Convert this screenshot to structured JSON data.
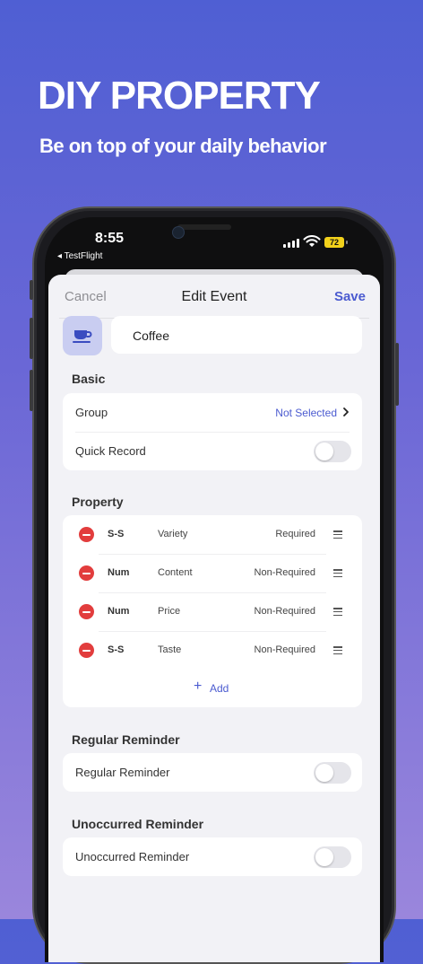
{
  "promo": {
    "headline": "DIY PROPERTY",
    "subhead": "Be on top of your daily behavior"
  },
  "status_bar": {
    "time": "8:55",
    "back_label": "◂ TestFlight",
    "battery": "72"
  },
  "nav": {
    "cancel": "Cancel",
    "title": "Edit Event",
    "save": "Save"
  },
  "event": {
    "icon": "coffee-cup-icon",
    "name": "Coffee"
  },
  "basic": {
    "label": "Basic",
    "group_label": "Group",
    "group_value": "Not Selected",
    "quick_record_label": "Quick Record",
    "quick_record_on": false
  },
  "property": {
    "label": "Property",
    "items": [
      {
        "type": "S-S",
        "name": "Variety",
        "requirement": "Required"
      },
      {
        "type": "Num",
        "name": "Content",
        "requirement": "Non-Required"
      },
      {
        "type": "Num",
        "name": "Price",
        "requirement": "Non-Required"
      },
      {
        "type": "S-S",
        "name": "Taste",
        "requirement": "Non-Required"
      }
    ],
    "add_label": "Add"
  },
  "regular_reminder": {
    "label": "Regular Reminder",
    "row_label": "Regular Reminder",
    "on": false
  },
  "unoccurred_reminder": {
    "label": "Unoccurred Reminder",
    "row_label": "Unoccurred Reminder",
    "on": false
  },
  "colors": {
    "accent": "#4b5bd0",
    "delete": "#e23d3d",
    "icon_bg": "#c9cdf1"
  }
}
